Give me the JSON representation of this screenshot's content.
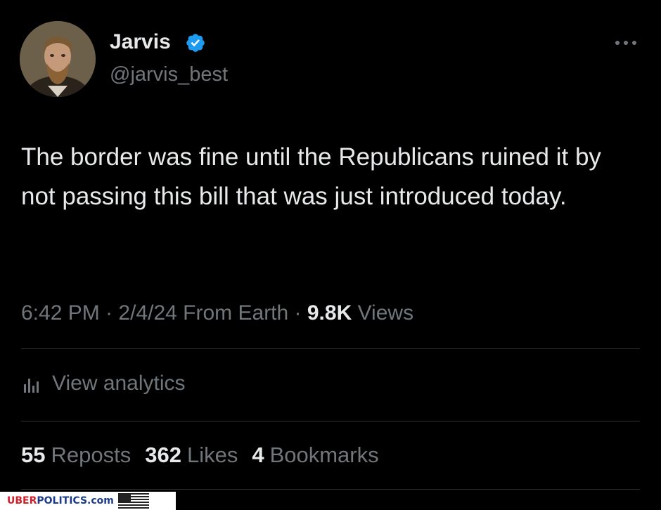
{
  "user": {
    "display_name": "Jarvis",
    "handle": "@jarvis_best",
    "verified": true
  },
  "tweet": {
    "text": "The border was fine until the Republicans ruined it by not passing this bill that was just introduced today.",
    "time": "6:42 PM",
    "date": "2/4/24",
    "source": "From Earth",
    "views_count": "9.8K",
    "views_label": "Views"
  },
  "analytics": {
    "label": "View analytics"
  },
  "stats": {
    "reposts_count": "55",
    "reposts_label": "Reposts",
    "likes_count": "362",
    "likes_label": "Likes",
    "bookmarks_count": "4",
    "bookmarks_label": "Bookmarks"
  },
  "watermark": {
    "uber": "UBER",
    "politics": "POLITICS.com"
  },
  "colors": {
    "background": "#000000",
    "primary_text": "#e7e9ea",
    "secondary_text": "#71767b",
    "verified_blue": "#1d9bf0",
    "divider": "#2f3336"
  },
  "icons": {
    "verified": "verified-badge-icon",
    "more": "more-options-icon",
    "analytics": "analytics-bar-chart-icon"
  }
}
